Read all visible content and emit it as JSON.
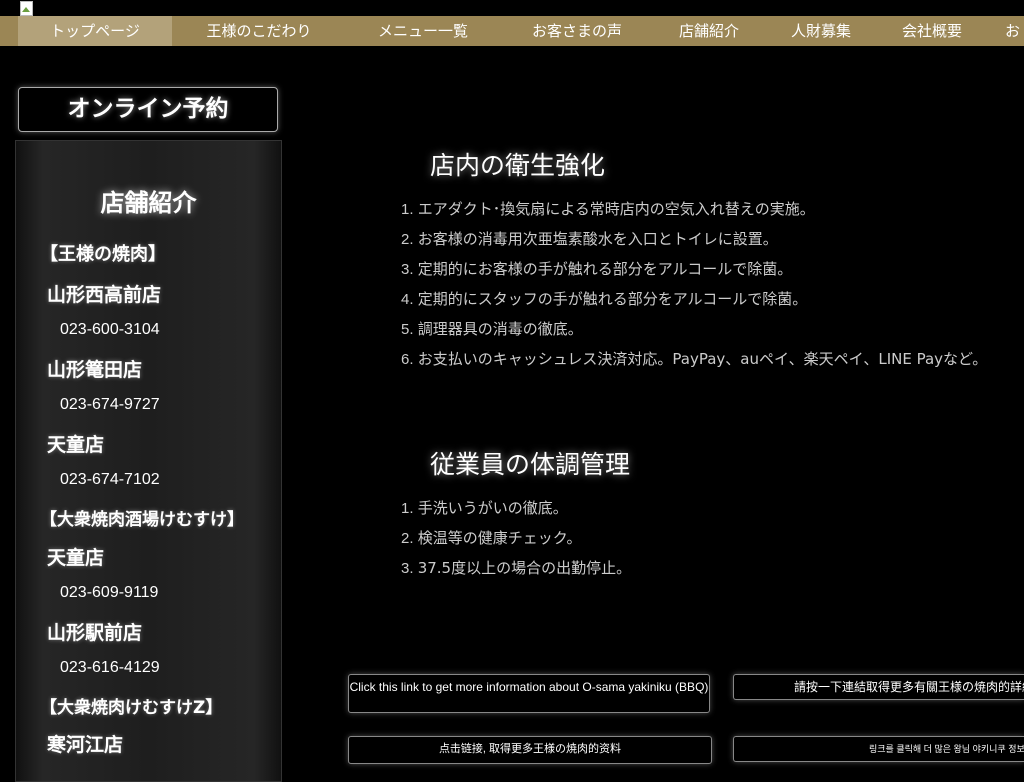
{
  "header": {
    "logo_alt": "broken-image-icon"
  },
  "nav": {
    "items": [
      {
        "label": "トップページ",
        "active": true
      },
      {
        "label": "王様のこだわり",
        "active": false
      },
      {
        "label": "メニュー一覧",
        "active": false
      },
      {
        "label": "お客さまの声",
        "active": false
      },
      {
        "label": "店舗紹介",
        "active": false
      },
      {
        "label": "人財募集",
        "active": false
      },
      {
        "label": "会社概要",
        "active": false
      },
      {
        "label": "お",
        "active": false
      }
    ]
  },
  "sidebar": {
    "reserve_label": "オンライン予約",
    "title": "店舗紹介",
    "brand1": "【王様の焼肉】",
    "store1_name": "山形西高前店",
    "store1_phone": "023-600-3104",
    "store2_name": "山形篭田店",
    "store2_phone": "023-674-9727",
    "store3_name": "天童店",
    "store3_phone": "023-674-7102",
    "brand2": "【大衆焼肉酒場けむすけ】",
    "store4_name": "天童店",
    "store4_phone": "023-609-9119",
    "store5_name": "山形駅前店",
    "store5_phone": "023-616-4129",
    "brand3": "【大衆焼肉けむすけZ】",
    "store6_name": "寒河江店"
  },
  "main": {
    "hygiene": {
      "title": "店内の衛生強化",
      "items": [
        "エアダクト･換気扇による常時店内の空気入れ替えの実施。",
        "お客様の消毒用次亜塩素酸水を入口とトイレに設置。",
        "定期的にお客様の手が触れる部分をアルコールで除菌。",
        "定期的にスタッフの手が触れる部分をアルコールで除菌。",
        "調理器具の消毒の徹底。",
        "お支払いのキャッシュレス決済対応。PayPay、auペイ、楽天ペイ、LINE Payなど。"
      ]
    },
    "staff": {
      "title": "従業員の体調管理",
      "items": [
        "手洗いうがいの徹底。",
        "検温等の健康チェック。",
        "37.5度以上の場合の出勤停止。"
      ]
    }
  },
  "links": {
    "en": "Click this link to get more information about O-sama yakiniku (BBQ)",
    "zh_tw": "請按一下連結取得更多有關王様の焼肉的詳細",
    "zh_cn": "点击链接, 取得更多王様の焼肉的资料",
    "ko": "링크를 클릭해 더 많은 왕님 야키니쿠 정보를 얻으세요"
  }
}
